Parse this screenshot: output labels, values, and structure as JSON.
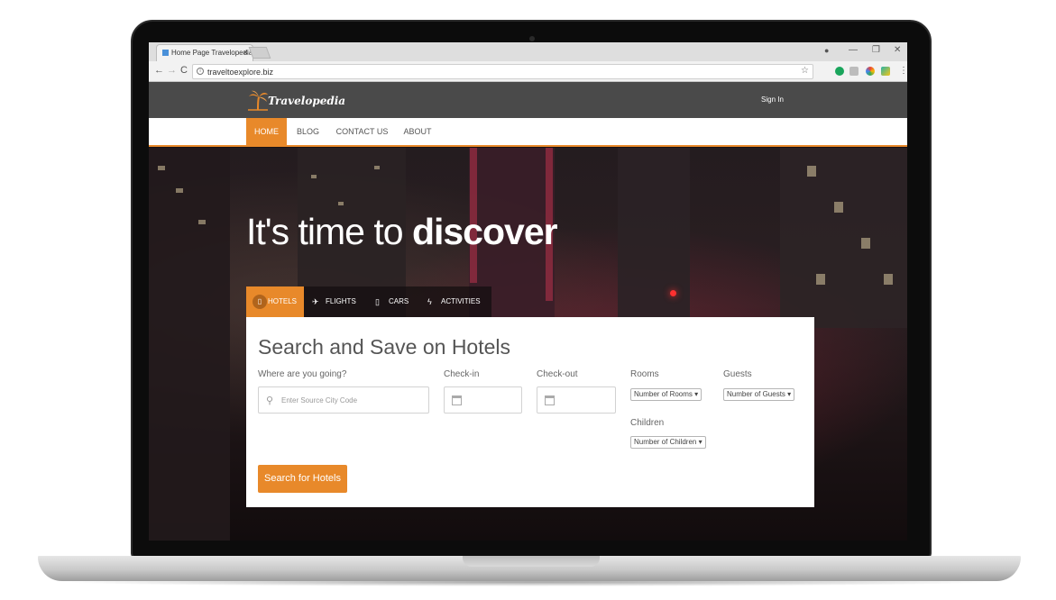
{
  "browser": {
    "tab_title": "Home Page Travelopedia",
    "tab_close": "×",
    "url": "traveltoexplore.biz",
    "nav_back": "←",
    "nav_forward": "→",
    "nav_reload": "C",
    "win_minimize": "—",
    "win_restore": "❐",
    "win_close": "✕",
    "star": "☆",
    "menu": "⋮",
    "profile": "●"
  },
  "site": {
    "logo_text": "Travelopedia",
    "sign_in": "Sign In",
    "nav": [
      {
        "label": "HOME",
        "active": true
      },
      {
        "label": "BLOG"
      },
      {
        "label": "CONTACT US"
      },
      {
        "label": "ABOUT"
      }
    ]
  },
  "hero": {
    "title_light": "It's time to ",
    "title_bold": "discover"
  },
  "search_tabs": [
    {
      "label": "HOTELS",
      "icon": "hotel-icon",
      "glyph": "▯"
    },
    {
      "label": "FLIGHTS",
      "icon": "plane-icon",
      "glyph": "✈"
    },
    {
      "label": "CARS",
      "icon": "car-icon",
      "glyph": "▯"
    },
    {
      "label": "ACTIVITIES",
      "icon": "bolt-icon",
      "glyph": "ϟ"
    }
  ],
  "search_panel": {
    "heading": "Search and Save on Hotels",
    "destination_label": "Where are you going?",
    "destination_placeholder": "Enter Source City Code",
    "checkin_label": "Check-in",
    "checkout_label": "Check-out",
    "rooms_label": "Rooms",
    "rooms_value": "Number of Rooms ▾",
    "guests_label": "Guests",
    "guests_value": "Number of Guests ▾",
    "children_label": "Children",
    "children_value": "Number of Children ▾",
    "submit_label": "Search for Hotels"
  },
  "colors": {
    "accent": "#e8892a",
    "header_bg": "#4a4a4a"
  }
}
